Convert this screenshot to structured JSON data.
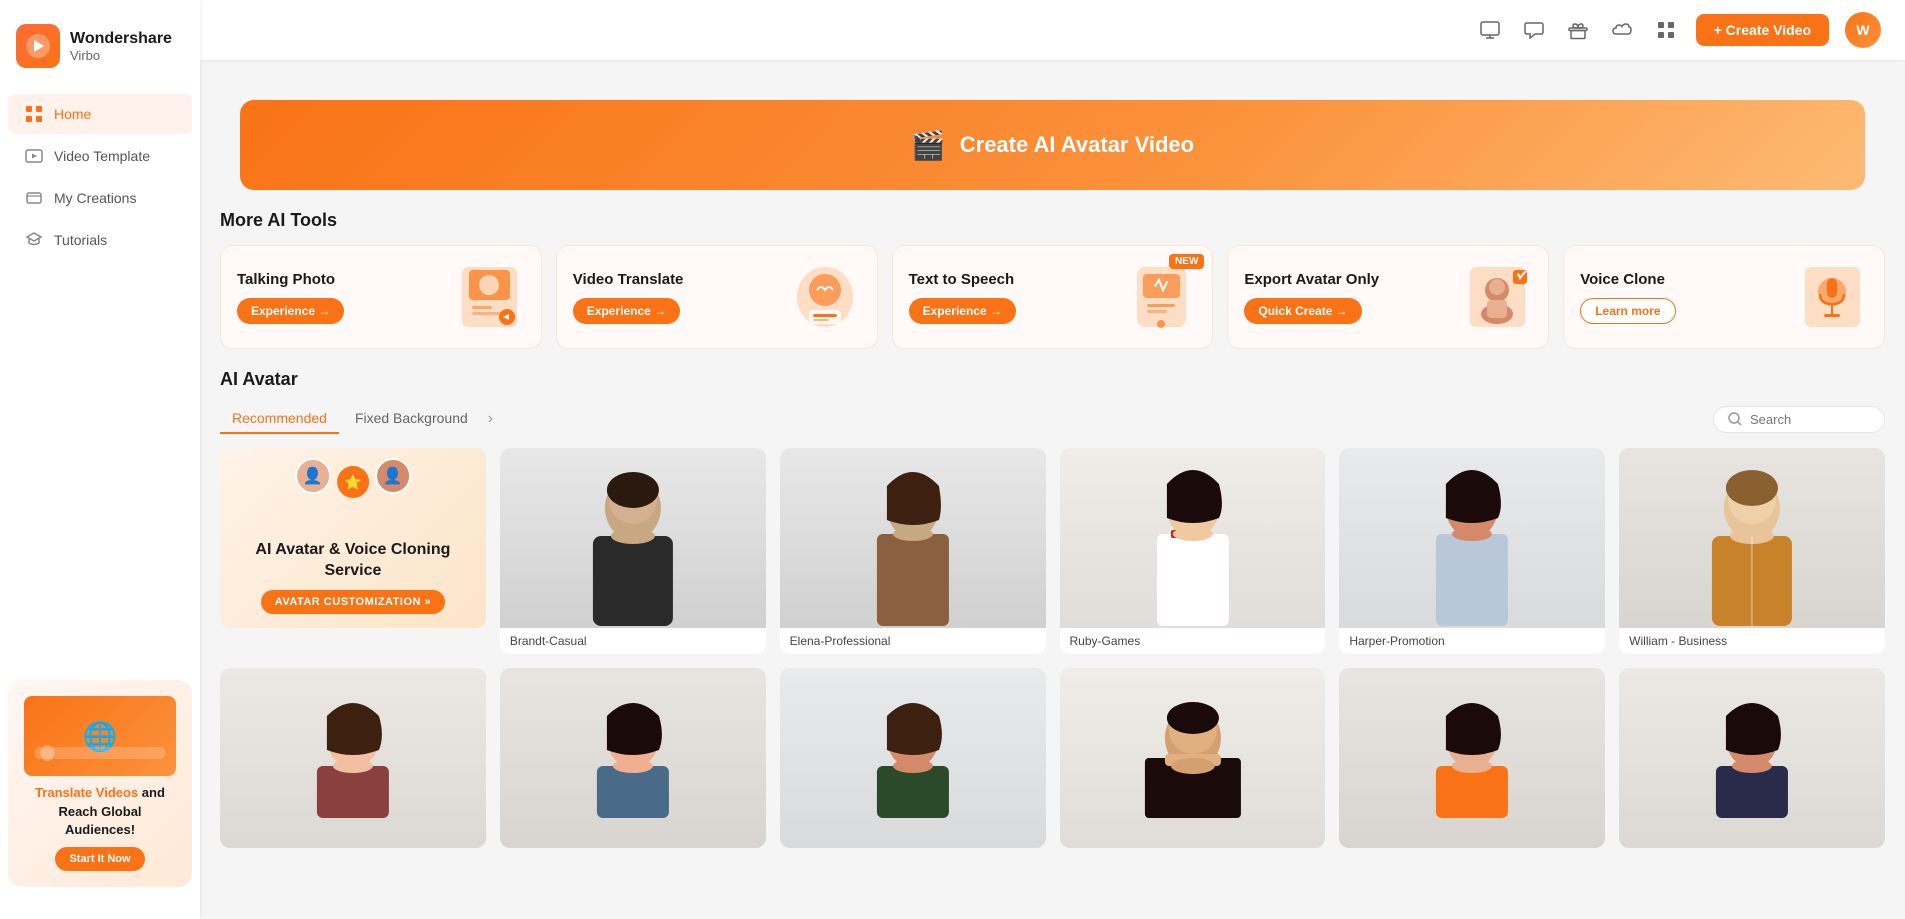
{
  "app": {
    "name": "Wondershare",
    "product": "Virbo"
  },
  "topbar": {
    "create_btn": "+ Create Video"
  },
  "sidebar": {
    "nav": [
      {
        "id": "home",
        "label": "Home",
        "active": true
      },
      {
        "id": "video-template",
        "label": "Video Template",
        "active": false
      },
      {
        "id": "my-creations",
        "label": "My Creations",
        "active": false
      },
      {
        "id": "tutorials",
        "label": "Tutorials",
        "active": false
      }
    ]
  },
  "hero": {
    "label": "Create AI Avatar Video"
  },
  "more_ai_tools": {
    "title": "More AI Tools",
    "tools": [
      {
        "id": "talking-photo",
        "title": "Talking Photo",
        "btn_label": "Experience →",
        "btn_type": "primary",
        "is_new": false,
        "icon": "📷"
      },
      {
        "id": "video-translate",
        "title": "Video Translate",
        "btn_label": "Experience →",
        "btn_type": "primary",
        "is_new": false,
        "icon": "🌐"
      },
      {
        "id": "text-to-speech",
        "title": "Text to Speech",
        "btn_label": "Experience →",
        "btn_type": "primary",
        "is_new": true,
        "icon": "🔊"
      },
      {
        "id": "export-avatar",
        "title": "Export Avatar Only",
        "btn_label": "Quick Create →",
        "btn_type": "primary",
        "is_new": false,
        "icon": "👤"
      },
      {
        "id": "voice-clone",
        "title": "Voice Clone",
        "btn_label": "Learn more",
        "btn_type": "outline",
        "is_new": false,
        "icon": "🎤"
      }
    ]
  },
  "ai_avatar": {
    "section_title": "AI Avatar",
    "tabs": [
      {
        "id": "recommended",
        "label": "Recommended",
        "active": true
      },
      {
        "id": "fixed-background",
        "label": "Fixed Background",
        "active": false
      }
    ],
    "search_placeholder": "Search",
    "avatars": [
      {
        "id": "custom",
        "type": "custom",
        "label": ""
      },
      {
        "id": "brandt",
        "name": "Brandt-Casual",
        "gender": "male",
        "skin": "#c8a882",
        "hair": "#2a1a0e",
        "shirt_color": "#2a2a2a",
        "is_hot": false
      },
      {
        "id": "elena",
        "name": "Elena-Professional",
        "gender": "female",
        "skin": "#c8a882",
        "hair": "#3d2010",
        "shirt_color": "#8b6040",
        "is_hot": false
      },
      {
        "id": "ruby",
        "name": "Ruby-Games",
        "gender": "female",
        "skin": "#f0c9a0",
        "hair": "#1a0a0a",
        "shirt_color": "#ffffff",
        "is_hot": false
      },
      {
        "id": "harper",
        "name": "Harper-Promotion",
        "gender": "female",
        "skin": "#d4896a",
        "hair": "#1a0a0a",
        "shirt_color": "#b8c8d8",
        "is_hot": false
      },
      {
        "id": "william",
        "name": "William - Business",
        "gender": "male",
        "skin": "#e8c49a",
        "hair": "#8b6030",
        "shirt_color": "#c8822a",
        "is_hot": true
      }
    ],
    "avatars_row2": [
      {
        "id": "r2_1",
        "name": "",
        "gender": "female",
        "skin": "#f0c0a0",
        "hair": "#3d2010"
      },
      {
        "id": "r2_2",
        "name": "",
        "gender": "female",
        "skin": "#f0b090",
        "hair": "#1a0a0a"
      },
      {
        "id": "r2_3",
        "name": "",
        "gender": "female",
        "skin": "#d4896a",
        "hair": "#3d2010"
      },
      {
        "id": "r2_4",
        "name": "",
        "gender": "male",
        "skin": "#d4a070",
        "hair": "#1a0a0a"
      },
      {
        "id": "r2_5",
        "name": "",
        "gender": "female",
        "skin": "#e8b090",
        "hair": "#1a0a0a"
      },
      {
        "id": "r2_6",
        "name": "",
        "gender": "female",
        "skin": "#d4896a",
        "hair": "#1a0a0a"
      }
    ]
  },
  "promo": {
    "title": "Translate Videos and Reach Global Audiences!",
    "btn": "Start It Now"
  },
  "avatar_custom": {
    "title": "AI Avatar & Voice Cloning Service",
    "btn": "AVATAR CUSTOMIZATION »"
  }
}
